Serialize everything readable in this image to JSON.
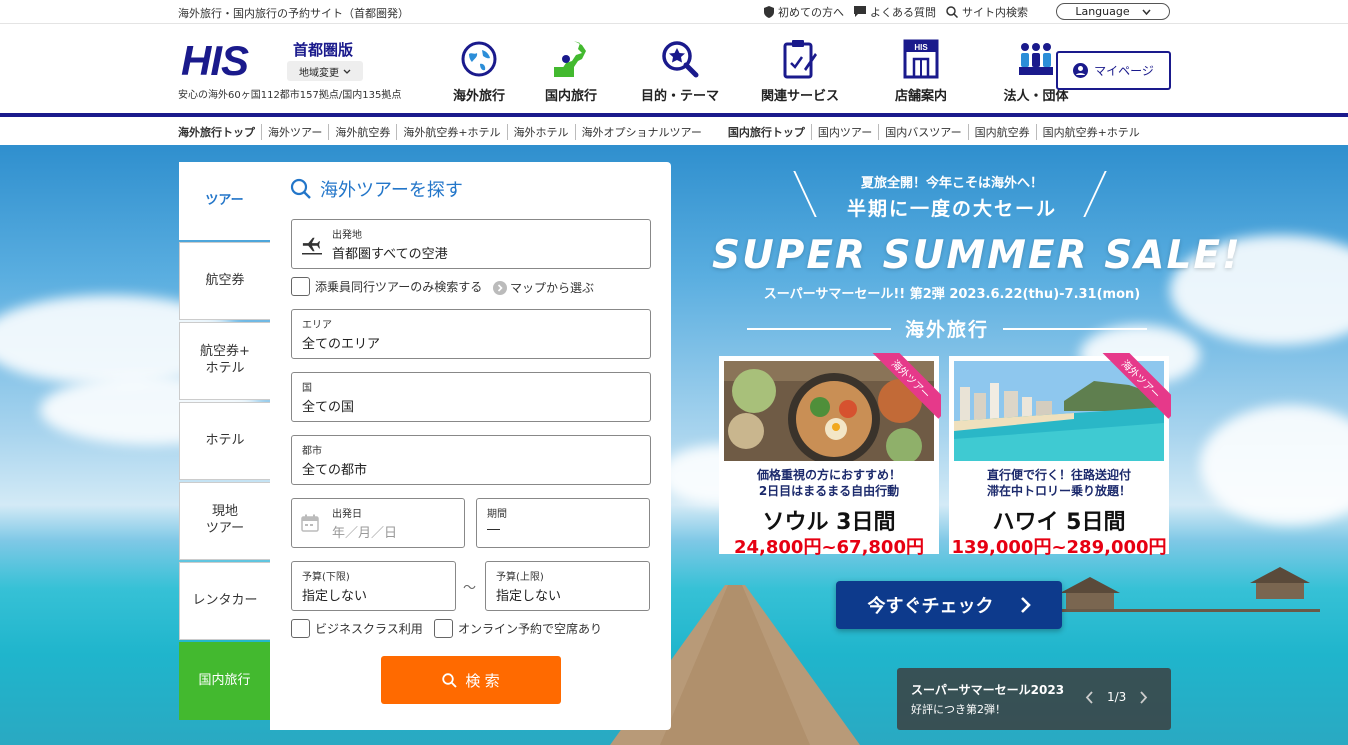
{
  "topbar": {
    "tagline": "海外旅行・国内旅行の予約サイト（首都圏発）",
    "links": [
      {
        "icon": "shield-icon",
        "label": "初めての方へ"
      },
      {
        "icon": "chat-icon",
        "label": "よくある質問"
      },
      {
        "icon": "search-icon",
        "label": "サイト内検索"
      }
    ],
    "language": "Language"
  },
  "header": {
    "logo": "HIS",
    "region": "首都圏版",
    "region_change": "地域変更",
    "store_note": "安心の海外60ヶ国112都市157拠点/国内135拠点",
    "nav": [
      {
        "icon": "globe-icon",
        "label": "海外旅行"
      },
      {
        "icon": "japan-map-icon",
        "label": "国内旅行"
      },
      {
        "icon": "theme-search-icon",
        "label": "目的・テーマ"
      },
      {
        "icon": "clipboard-icon",
        "label": "関連サービス"
      },
      {
        "icon": "store-icon",
        "label": "店舗案内"
      },
      {
        "icon": "group-icon",
        "label": "法人・団体"
      }
    ],
    "mypage": "マイページ",
    "colors": {
      "brand": "#1a1a8c",
      "accent_blue": "#2376c9",
      "orange": "#ff6a00",
      "green": "#43b92f",
      "sale_red": "#e60012",
      "ribbon_pink": "#e6398a"
    }
  },
  "subnav": {
    "overseas": [
      "海外旅行トップ",
      "海外ツアー",
      "海外航空券",
      "海外航空券+ホテル",
      "海外ホテル",
      "海外オプショナルツアー"
    ],
    "domestic": [
      "国内旅行トップ",
      "国内ツアー",
      "国内バスツアー",
      "国内航空券",
      "国内航空券+ホテル"
    ]
  },
  "side_tabs": [
    "ツアー",
    "航空券",
    "航空券+\nホテル",
    "ホテル",
    "現地\nツアー",
    "レンタカー",
    "国内旅行"
  ],
  "search": {
    "title": "海外ツアーを探す",
    "departure_label": "出発地",
    "departure_value": "首都圏すべての空港",
    "conductor_only": "添乗員同行ツアーのみ検索する",
    "map_select": "マップから選ぶ",
    "area_label": "エリア",
    "area_value": "全てのエリア",
    "country_label": "国",
    "country_value": "全ての国",
    "city_label": "都市",
    "city_value": "全ての都市",
    "date_label": "出発日",
    "date_placeholder": "年／月／日",
    "duration_label": "期間",
    "duration_value": "―",
    "budget_min_label": "予算(下限)",
    "budget_min_value": "指定しない",
    "budget_sep": "～",
    "budget_max_label": "予算(上限)",
    "budget_max_value": "指定しない",
    "business_class": "ビジネスクラス利用",
    "online_available": "オンライン予約で空席あり",
    "submit": "検 索"
  },
  "promo": {
    "line1": "夏旅全開！今年こそは海外へ！",
    "line2": "半期に一度の大セール",
    "headline": "SUPER SUMMER SALE!",
    "subline": "スーパーサマーセール!! 第2弾 2023.6.22(thu)-7.31(mon)",
    "category": "海外旅行",
    "cards": [
      {
        "ribbon": "海外ツアー",
        "desc1": "価格重視の方におすすめ！",
        "desc2": "2日目はまるまる自由行動",
        "dest": "ソウル 3日間",
        "price": "24,800円~67,800円"
      },
      {
        "ribbon": "海外ツアー",
        "desc1": "直行便で行く！往路送迎付",
        "desc2": "滞在中トロリー乗り放題！",
        "dest": "ハワイ 5日間",
        "price": "139,000円~289,000円"
      }
    ],
    "cta": "今すぐチェック"
  },
  "slider": {
    "title": "スーパーサマーセール2023",
    "subtitle": "好評につき第2弾！",
    "counter": "1/3"
  }
}
